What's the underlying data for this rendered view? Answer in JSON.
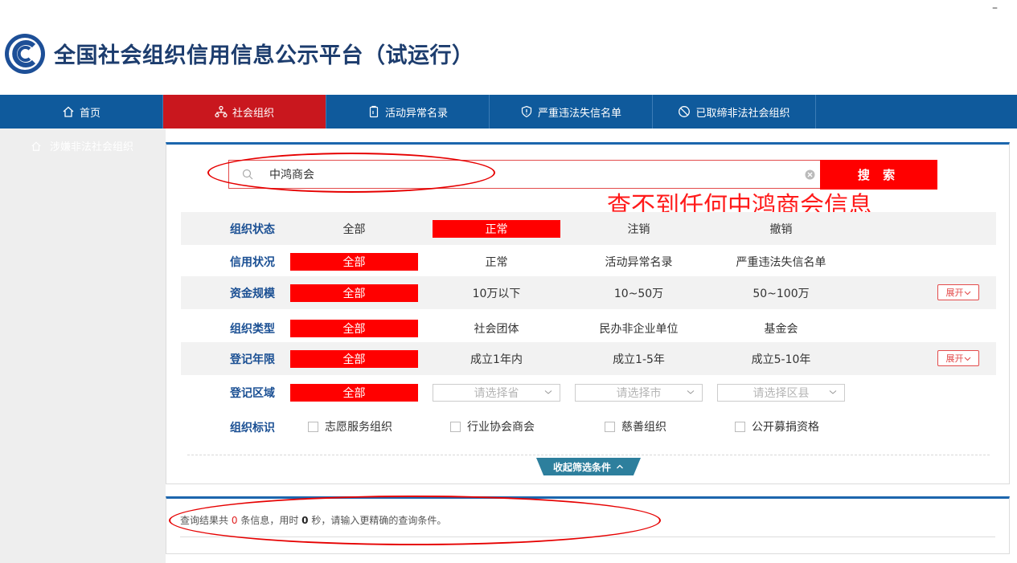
{
  "window": {
    "minimize_symbol": "–"
  },
  "header": {
    "title": "全国社会组织信用信息公示平台（试运行）",
    "logo_icon": "platform-logo-icon"
  },
  "nav": {
    "items": [
      {
        "label": "首页",
        "icon": "home-icon"
      },
      {
        "label": "社会组织",
        "icon": "organization-icon",
        "active": true
      },
      {
        "label": "活动异常名录",
        "icon": "clipboard-icon"
      },
      {
        "label": "严重违法失信名单",
        "icon": "shield-icon"
      },
      {
        "label": "已取缔非法社会组织",
        "icon": "ban-icon"
      }
    ]
  },
  "sidebar": {
    "item_label": "涉嫌非法社会组织",
    "icon": "home-outline-icon"
  },
  "search": {
    "value": "中鸿商会",
    "button_label": "搜 索"
  },
  "annotation": {
    "note": "查不到任何中鸿商会信息"
  },
  "filters": {
    "status": {
      "label": "组织状态",
      "options": [
        "全部",
        "正常",
        "注销",
        "撤销"
      ],
      "selected": "正常"
    },
    "credit": {
      "label": "信用状况",
      "options": [
        "全部",
        "正常",
        "活动异常名录",
        "严重违法失信名单"
      ],
      "selected": "全部"
    },
    "capital": {
      "label": "资金规模",
      "options": [
        "全部",
        "10万以下",
        "10~50万",
        "50~100万"
      ],
      "selected": "全部",
      "expand": "展开"
    },
    "type": {
      "label": "组织类型",
      "options": [
        "全部",
        "社会团体",
        "民办非企业单位",
        "基金会"
      ],
      "selected": "全部"
    },
    "years": {
      "label": "登记年限",
      "options": [
        "全部",
        "成立1年内",
        "成立1-5年",
        "成立5-10年"
      ],
      "selected": "全部",
      "expand": "展开"
    },
    "region": {
      "label": "登记区域",
      "all": "全部",
      "province_placeholder": "请选择省",
      "city_placeholder": "请选择市",
      "county_placeholder": "请选择区县"
    },
    "tags": {
      "label": "组织标识",
      "options": [
        "志愿服务组织",
        "行业协会商会",
        "慈善组织",
        "公开募捐资格"
      ]
    },
    "collapse_label": "收起筛选条件"
  },
  "results": {
    "prefix": "查询结果共",
    "count": "0",
    "mid": "条信息，用时",
    "seconds": "0",
    "suffix": "秒，请输入更精确的查询条件。"
  },
  "colors": {
    "nav_bg": "#0f5a9c",
    "active_red": "#c9171e",
    "accent_red": "#ff0000",
    "label_blue": "#1a4f93"
  }
}
